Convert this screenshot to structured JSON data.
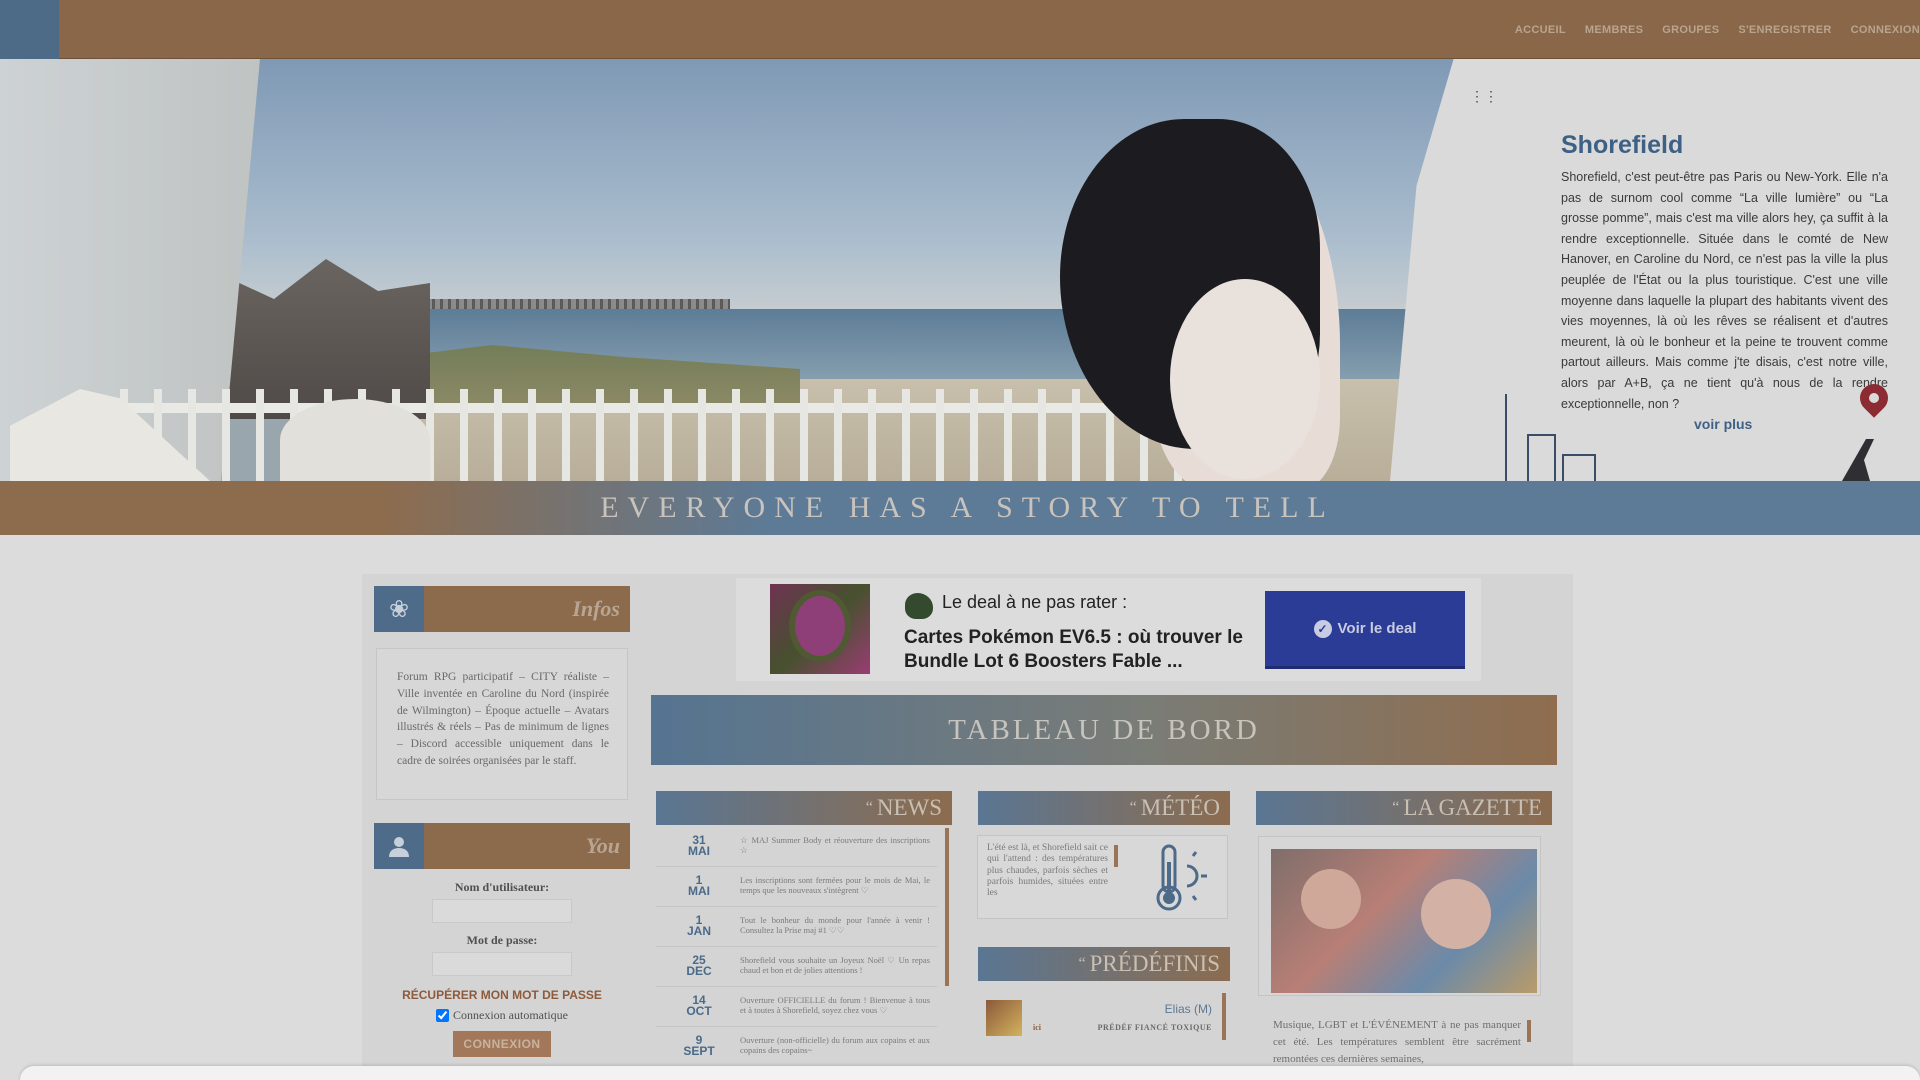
{
  "nav": {
    "items": [
      "ACCUEIL",
      "MEMBRES",
      "GROUPES",
      "S'ENREGISTRER",
      "CONNEXION"
    ]
  },
  "hero": {
    "title": "Shorefield",
    "text": "Shorefield, c'est peut-être pas Paris ou New-York. Elle n'a pas de surnom cool comme “La ville lumière” ou “La grosse pomme”, mais c'est ma ville alors hey, ça suffit à la rendre exceptionnelle. Située dans le comté de New Hanover, en Caroline du Nord, ce n'est pas la ville la plus peuplée de l'État ou la plus touristique. C'est une ville moyenne dans laquelle la plupart des habitants vivent des vies moyennes, là où les rêves se réalisent et d'autres meurent, là où le bonheur et la peine te trouvent comme partout ailleurs. Mais comme j'te disais, c'est notre ville, alors par A+B, ça ne tient qu'à nous de la rendre exceptionnelle, non ?",
    "more": "voir plus"
  },
  "tagline": "EVERYONE HAS A STORY TO TELL",
  "infos": {
    "heading": "Infos",
    "text": "Forum RPG participatif – CITY réaliste – Ville inventée en Caroline du Nord (inspirée de Wilmington) – Époque actuelle – Avatars illustrés & réels – Pas de minimum de lignes – Discord accessible uniquement dans le cadre de soirées organisées par le staff."
  },
  "you": {
    "heading": "You",
    "username_label": "Nom d'utilisateur:",
    "password_label": "Mot de passe:",
    "forgot": "RÉCUPÉRER MON MOT DE PASSE",
    "auto": "Connexion automatique",
    "button": "CONNEXION"
  },
  "deal": {
    "label": "Le deal à ne pas rater :",
    "title": "Cartes Pokémon EV6.5 : où trouver le Bundle Lot 6 Boosters Fable ...",
    "button": "Voir le deal"
  },
  "dashboard": {
    "title": "TABLEAU DE BORD"
  },
  "news": {
    "heading": "NEWS",
    "items": [
      {
        "day": "31",
        "month": "MAI",
        "text": "☆ MAJ Summer Body et réouverture des inscriptions ☆"
      },
      {
        "day": "1",
        "month": "MAI",
        "text": "Les inscriptions sont fermées pour le mois de Mai, le temps que les nouveaux s'intègrent ♡"
      },
      {
        "day": "1",
        "month": "JAN",
        "text": "Tout le bonheur du monde pour l'année à venir ! Consultez la Prise maj #1 ♡♡"
      },
      {
        "day": "25",
        "month": "DEC",
        "text": "Shorefield vous souhaite un Joyeux Noël ♡ Un repas chaud et bon et de jolies attentions !"
      },
      {
        "day": "14",
        "month": "OCT",
        "text": "Ouverture OFFICIELLE du forum ! Bienvenue à tous et à toutes à Shorefield, soyez chez vous ♡"
      },
      {
        "day": "9",
        "month": "SEPT",
        "text": "Ouverture (non-officielle) du forum aux copains et aux copains des copains~"
      }
    ]
  },
  "meteo": {
    "heading": "MÉTÉO",
    "text": "L'été est là, et Shorefield sait ce qui l'attend : des températures plus chaudes, parfois sèches et parfois humides, situées entre les"
  },
  "predefinis": {
    "heading": "PRÉDÉFINIS",
    "items": [
      {
        "name": "Elias (M)",
        "link": "ici",
        "desc": "PRÉDÉF FIANCÉ TOXIQUE"
      }
    ]
  },
  "gazette": {
    "heading": "LA GAZETTE",
    "text": "Musique, LGBT et L'ÉVÉNEMENT à ne pas manquer cet été. Les températures semblent être sacrément remontées ces dernières semaines,"
  }
}
